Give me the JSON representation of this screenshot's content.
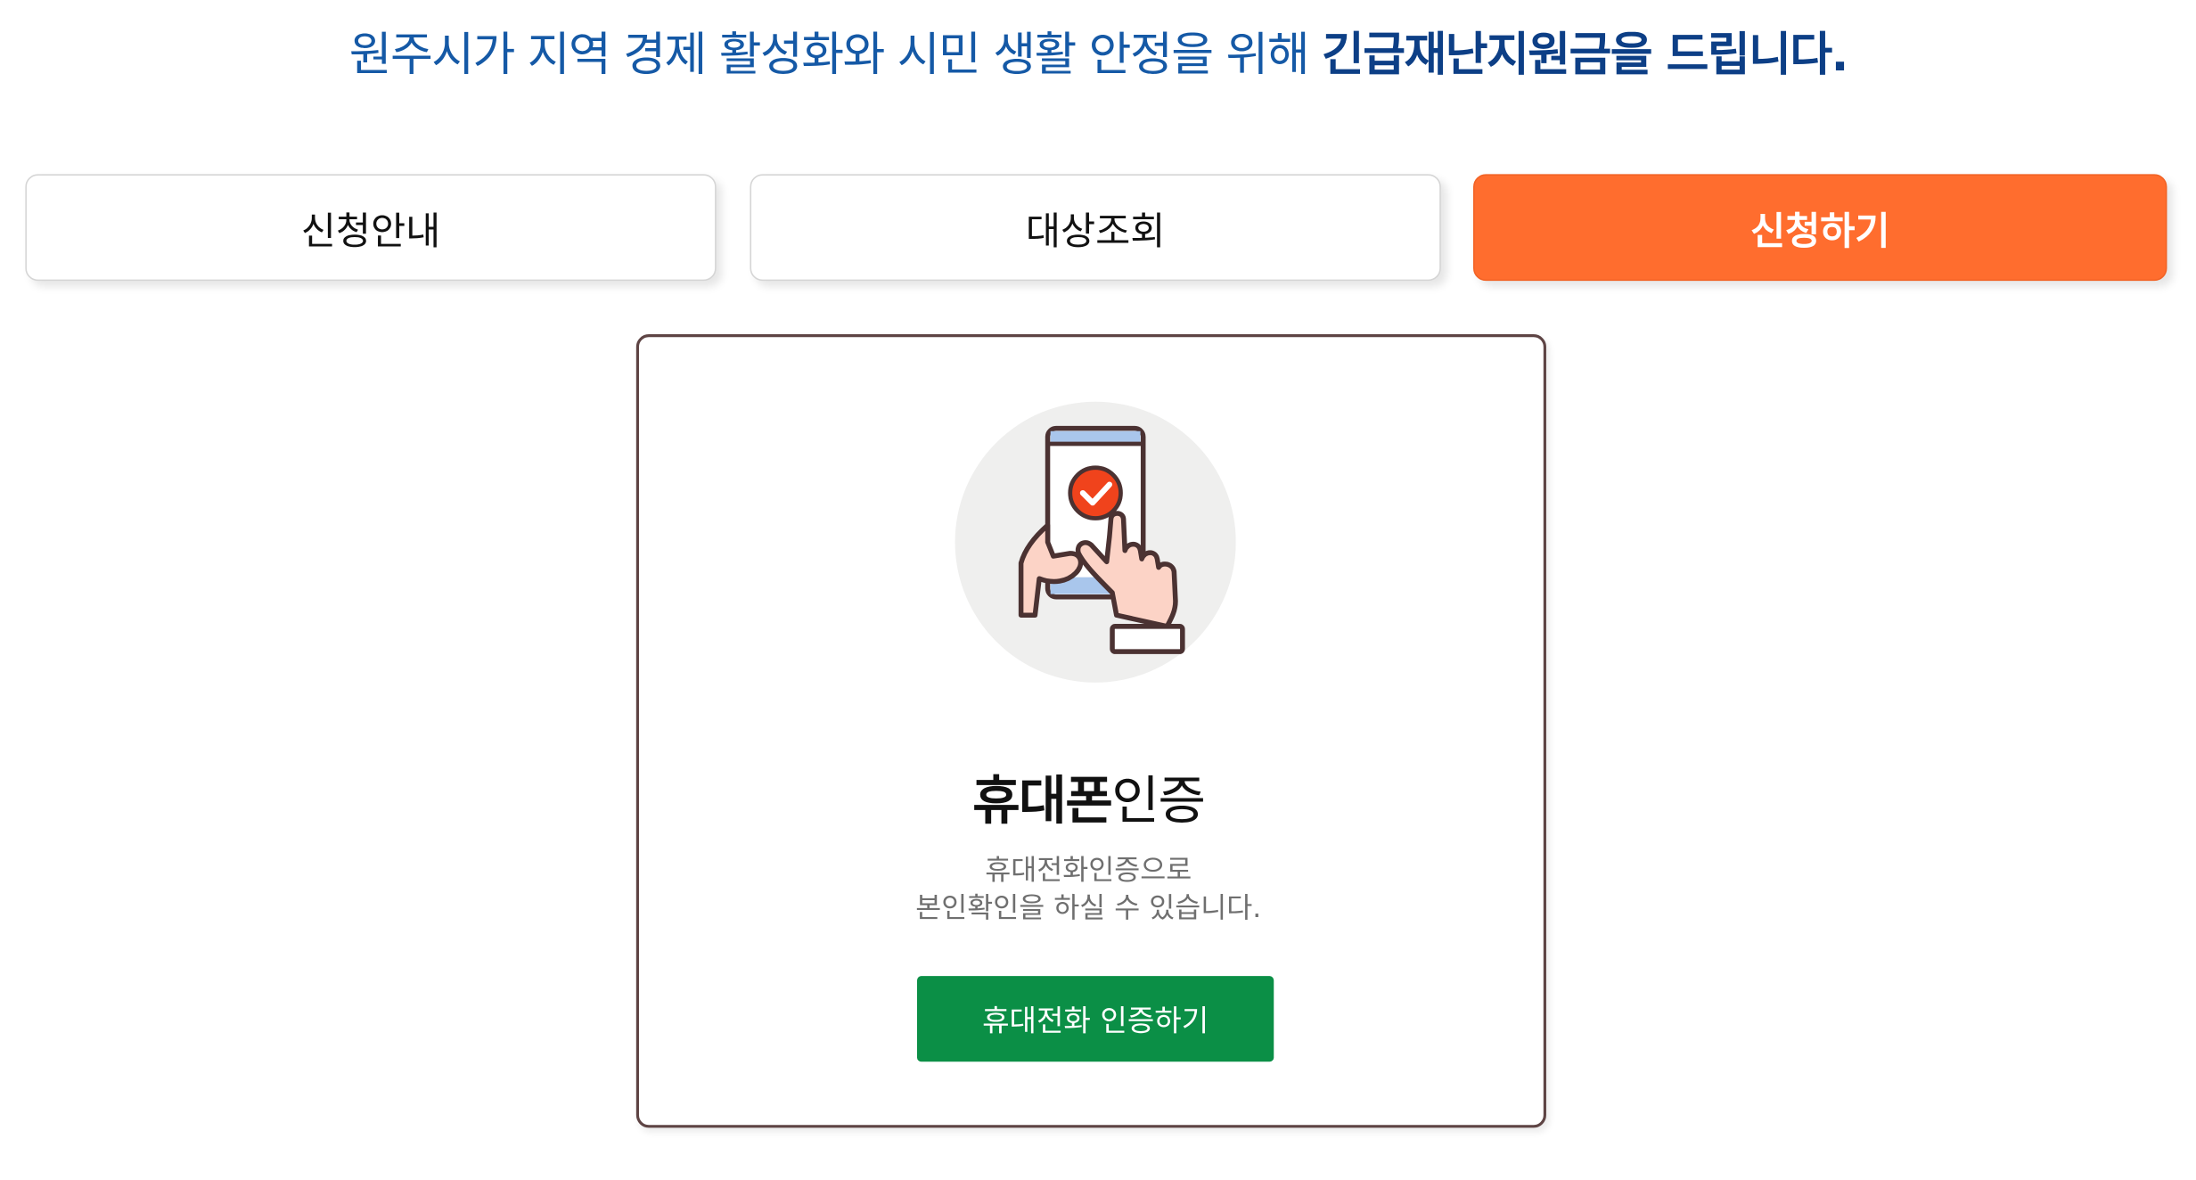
{
  "header": {
    "headline_prefix": "원주시가 지역 경제 활성화와 시민 생활 안정을 위해 ",
    "headline_emphasis": "긴급재난지원금을 드립니다."
  },
  "tabs": [
    {
      "label": "신청안내",
      "active": false
    },
    {
      "label": "대상조회",
      "active": false
    },
    {
      "label": "신청하기",
      "active": true
    }
  ],
  "auth_card": {
    "icon": "phone-check-hand-icon",
    "title_bold": "휴대폰",
    "title_regular": "인증",
    "description_line1": "휴대전화인증으로",
    "description_line2": "본인확인을 하실 수 있습니다.",
    "button_label": "휴대전화 인증하기"
  },
  "colors": {
    "headline": "#1559a6",
    "active_tab": "#ff6d2e",
    "card_border": "#5e4444",
    "button": "#0b8f46",
    "check_badge": "#f0431c"
  }
}
